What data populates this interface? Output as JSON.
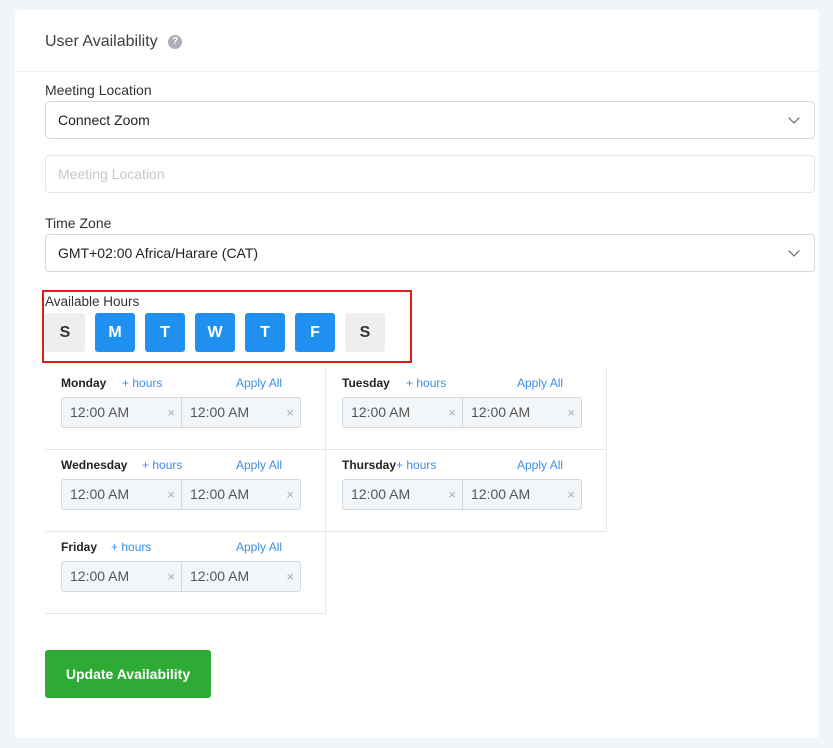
{
  "header": {
    "title": "User Availability",
    "help_icon": "?"
  },
  "meeting_location": {
    "label": "Meeting Location",
    "selected": "Connect Zoom",
    "input_placeholder": "Meeting Location"
  },
  "time_zone": {
    "label": "Time Zone",
    "selected": "GMT+02:00 Africa/Harare (CAT)"
  },
  "available_hours": {
    "label": "Available Hours",
    "days": [
      {
        "label": "S",
        "active": false
      },
      {
        "label": "M",
        "active": true
      },
      {
        "label": "T",
        "active": true
      },
      {
        "label": "W",
        "active": true
      },
      {
        "label": "T",
        "active": true
      },
      {
        "label": "F",
        "active": true
      },
      {
        "label": "S",
        "active": false
      }
    ]
  },
  "schedule": [
    {
      "day": "Monday",
      "add": "+ hours",
      "apply": "Apply All",
      "start": "12:00 AM",
      "end": "12:00 AM"
    },
    {
      "day": "Tuesday",
      "add": "+ hours",
      "apply": "Apply All",
      "start": "12:00 AM",
      "end": "12:00 AM"
    },
    {
      "day": "Wednesday",
      "add": "+ hours",
      "apply": "Apply All",
      "start": "12:00 AM",
      "end": "12:00 AM"
    },
    {
      "day": "Thursday",
      "add": "+ hours",
      "apply": "Apply All",
      "start": "12:00 AM",
      "end": "12:00 AM"
    },
    {
      "day": "Friday",
      "add": "+ hours",
      "apply": "Apply All",
      "start": "12:00 AM",
      "end": "12:00 AM"
    }
  ],
  "clear_symbol": "×",
  "update_button": "Update Availability",
  "colors": {
    "accent": "#1f8ff0",
    "button": "#2eab34",
    "highlight": "#e01b1b"
  }
}
